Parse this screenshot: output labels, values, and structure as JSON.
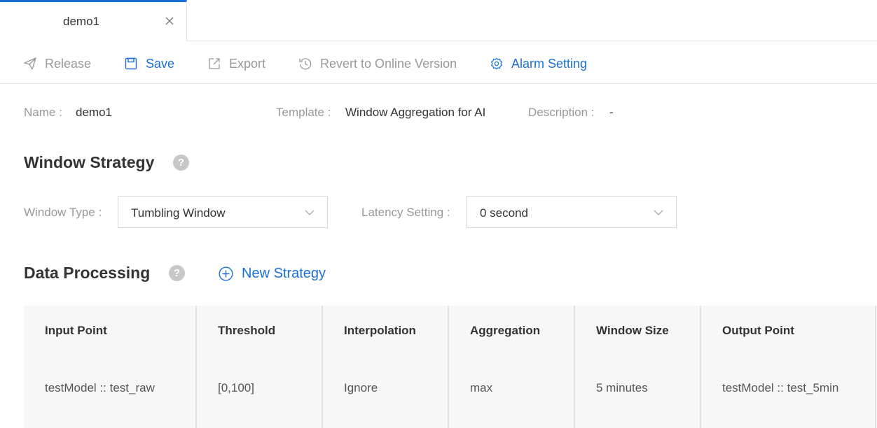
{
  "tab": {
    "label": "demo1"
  },
  "toolbar": {
    "release": "Release",
    "save": "Save",
    "export": "Export",
    "revert": "Revert to Online Version",
    "alarm": "Alarm Setting"
  },
  "info": {
    "name_label": "Name :",
    "name_value": "demo1",
    "template_label": "Template :",
    "template_value": "Window Aggregation for AI",
    "description_label": "Description :",
    "description_value": "-"
  },
  "window_strategy": {
    "title": "Window Strategy",
    "help": "?",
    "window_type_label": "Window Type :",
    "window_type_value": "Tumbling Window",
    "latency_label": "Latency Setting :",
    "latency_value": "0 second"
  },
  "data_processing": {
    "title": "Data Processing",
    "help": "?",
    "new_strategy": "New Strategy"
  },
  "table": {
    "columns": [
      "Input Point",
      "Threshold",
      "Interpolation",
      "Aggregation",
      "Window Size",
      "Output Point"
    ],
    "rows": [
      [
        "testModel :: test_raw",
        "[0,100]",
        "Ignore",
        "max",
        "5 minutes",
        "testModel :: test_5min"
      ]
    ]
  },
  "colors": {
    "accent": "#1a6fd8",
    "muted": "#999999",
    "table_bg": "#f7f7f7"
  }
}
